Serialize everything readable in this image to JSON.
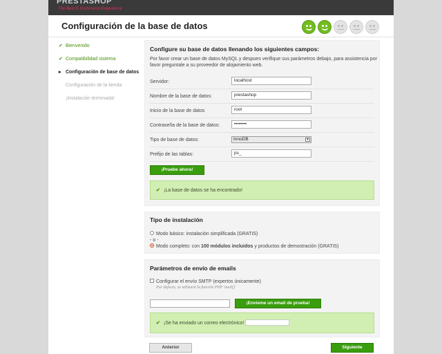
{
  "brand": {
    "logo": "PRESTASHOP",
    "tagline": "The Best E-Commerce Experience"
  },
  "header": {
    "title": "Configuración de la base de datos"
  },
  "progress": {
    "states": [
      "on",
      "on",
      "off",
      "off",
      "off"
    ]
  },
  "sidebar": {
    "steps": [
      {
        "label": "Bienvenido",
        "state": "done",
        "mark": "✔"
      },
      {
        "label": "Compatibilidad sistema",
        "state": "done",
        "mark": "✔"
      },
      {
        "label": "Configuración de base de datos",
        "state": "current",
        "mark": "▸"
      },
      {
        "label": "Configuración de la tienda",
        "state": "todo",
        "mark": ""
      },
      {
        "label": "¡Instalación terminada!",
        "state": "todo",
        "mark": ""
      }
    ]
  },
  "db": {
    "heading": "Configure su base de datos llenando los siguientes campos:",
    "description": "Por favor crear un base de datos MySQL y despues verifique sus parámetros debajo, para assistencia por favor preguntale a su proveedor de alojamiento web.",
    "fields": {
      "server": {
        "label": "Servidor:",
        "value": "localhost"
      },
      "dbname": {
        "label": "Nombre de la base de datos:",
        "value": "prestashop"
      },
      "login": {
        "label": "Inicio de la base de datos",
        "value": "root"
      },
      "password": {
        "label": "Contraseña de la base de datos:",
        "value": "••••••••"
      },
      "engine": {
        "label": "Tipo de base de datos:",
        "value": "InnoDB"
      },
      "prefix": {
        "label": "Prefijo de las tablas:",
        "value": "ps_"
      }
    },
    "test_button": "¡Pruebe ahora!",
    "success": "¡La base de datos se ha encontrado!"
  },
  "install": {
    "heading": "Tipo de instalación",
    "basic": "Modo básico: instalación simplificada (GRATIS)",
    "separator": "- o -",
    "full_pre": "Modo completo: con ",
    "full_bold": "100 módulos incluidos",
    "full_post": " y productos de demostración (GRATIS)",
    "selected": "full"
  },
  "email": {
    "heading": "Parámetros de envío de emails",
    "smtp_label": "Configurar el envío SMTP (expertos únicamente)",
    "smtp_hint": "Por defecto, se utilizará la función PHP 'mail()'",
    "email_value": "",
    "test_button": "¡Envíeme un email de prueba!",
    "sent_text": "¡Se ha enviado un correo electrónico!"
  },
  "nav": {
    "prev": "Anterior",
    "next": "Siguiente"
  },
  "colors": {
    "accent_green": "#3a9d0e",
    "success_bg": "#d1efb2",
    "topbar": "#3a3a3a"
  }
}
